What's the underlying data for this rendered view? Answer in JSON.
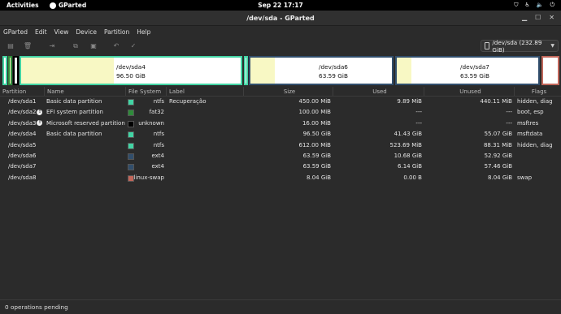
{
  "topbar": {
    "activities": "Activities",
    "app_name": "GParted",
    "clock": "Sep 22  17:17"
  },
  "window": {
    "title": "/dev/sda - GParted"
  },
  "menu": [
    "GParted",
    "Edit",
    "View",
    "Device",
    "Partition",
    "Help"
  ],
  "device_select": "/dev/sda (232.89 GiB)",
  "map": {
    "sda4": {
      "name": "/dev/sda4",
      "size": "96.50 GiB"
    },
    "sda6": {
      "name": "/dev/sda6",
      "size": "63.59 GiB"
    },
    "sda7": {
      "name": "/dev/sda7",
      "size": "63.59 GiB"
    }
  },
  "columns": [
    "Partition",
    "Name",
    "File System",
    "Label",
    "Size",
    "Used",
    "Unused",
    "Flags"
  ],
  "rows": [
    {
      "partition": "/dev/sda1",
      "info": false,
      "name": "Basic data partition",
      "fs": "ntfs",
      "fs_color": "#42d4a4",
      "label": "Recuperação",
      "size": "450.00 MiB",
      "used": "9.89 MiB",
      "unused": "440.11 MiB",
      "flags": "hidden, diag"
    },
    {
      "partition": "/dev/sda2",
      "info": true,
      "name": "EFI system partition",
      "fs": "fat32",
      "fs_color": "#2e8b3a",
      "label": "",
      "size": "100.00 MiB",
      "used": "---",
      "unused": "---",
      "flags": "boot, esp"
    },
    {
      "partition": "/dev/sda3",
      "info": true,
      "name": "Microsoft reserved partition",
      "fs": "unknown",
      "fs_color": "#000000",
      "label": "",
      "size": "16.00 MiB",
      "used": "---",
      "unused": "---",
      "flags": "msftres"
    },
    {
      "partition": "/dev/sda4",
      "info": false,
      "name": "Basic data partition",
      "fs": "ntfs",
      "fs_color": "#42d4a4",
      "label": "",
      "size": "96.50 GiB",
      "used": "41.43 GiB",
      "unused": "55.07 GiB",
      "flags": "msftdata"
    },
    {
      "partition": "/dev/sda5",
      "info": false,
      "name": "",
      "fs": "ntfs",
      "fs_color": "#42d4a4",
      "label": "",
      "size": "612.00 MiB",
      "used": "523.69 MiB",
      "unused": "88.31 MiB",
      "flags": "hidden, diag"
    },
    {
      "partition": "/dev/sda6",
      "info": false,
      "name": "",
      "fs": "ext4",
      "fs_color": "#314e6c",
      "label": "",
      "size": "63.59 GiB",
      "used": "10.68 GiB",
      "unused": "52.92 GiB",
      "flags": ""
    },
    {
      "partition": "/dev/sda7",
      "info": false,
      "name": "",
      "fs": "ext4",
      "fs_color": "#314e6c",
      "label": "",
      "size": "63.59 GiB",
      "used": "6.14 GiB",
      "unused": "57.46 GiB",
      "flags": ""
    },
    {
      "partition": "/dev/sda8",
      "info": false,
      "name": "",
      "fs": "linux-swap",
      "fs_color": "#c1665a",
      "label": "",
      "size": "8.04 GiB",
      "used": "0.00 B",
      "unused": "8.04 GiB",
      "flags": "swap"
    }
  ],
  "status": "0 operations pending",
  "colors": {
    "ntfs": "#42d4a4",
    "ext4": "#314e6c",
    "swap": "#c1665a",
    "used_fill": "#f8f8c4"
  }
}
